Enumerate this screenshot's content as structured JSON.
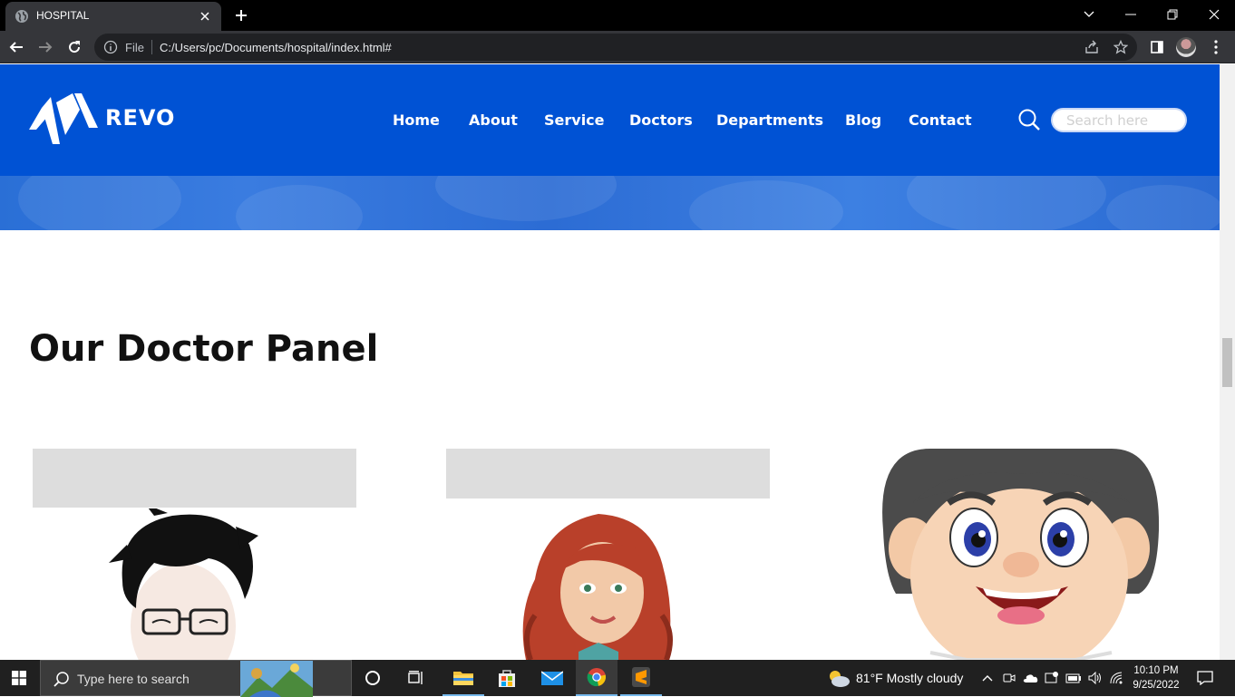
{
  "browser": {
    "tab_title": "HOSPITAL",
    "address_scheme_label": "File",
    "url": "C:/Users/pc/Documents/hospital/index.html#"
  },
  "site": {
    "logo_text": "REVO",
    "nav": [
      "Home",
      "About",
      "Service",
      "Doctors",
      "Departments",
      "Blog",
      "Contact"
    ],
    "search_placeholder": "Search here",
    "brand_color": "#0052d4"
  },
  "section": {
    "title": "Our Doctor Panel"
  },
  "doctors": [
    {
      "avatar": "cartoon-man-glasses"
    },
    {
      "avatar": "cartoon-woman-red-hair"
    },
    {
      "avatar": "cartoon-boy-smiling"
    }
  ],
  "taskbar": {
    "search_placeholder": "Type here to search",
    "weather": "81°F  Mostly cloudy",
    "time": "10:10 PM",
    "date": "9/25/2022"
  }
}
